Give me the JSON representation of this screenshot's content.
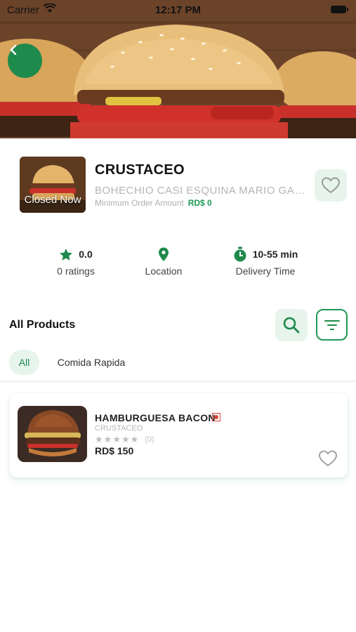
{
  "status_bar": {
    "carrier": "Carrier",
    "time": "12:17 PM"
  },
  "restaurant": {
    "name": "CRUSTACEO",
    "status": "Closed Now",
    "address": "BOHECHIO CASI ESQUINA MARIO GARCIA",
    "min_order_label": "Minimum Order Amount",
    "min_order_amount": "RD$ 0"
  },
  "stats": {
    "rating_value": "0.0",
    "rating_label": "0 ratings",
    "location_label": "Location",
    "delivery_value": "10-55 min",
    "delivery_label": "Delivery Time"
  },
  "products_section": {
    "title": "All Products"
  },
  "categories": [
    {
      "label": "All",
      "selected": true
    },
    {
      "label": "Comida Rapida",
      "selected": false
    }
  ],
  "products": [
    {
      "name": "HAMBURGUESA BACON",
      "restaurant": "CRUSTACEO",
      "rating": 0,
      "rating_count": "(0)",
      "price": "RD$ 150",
      "favorite": false
    }
  ],
  "icons": {
    "back": "chevron-left-icon",
    "favorite": "heart-outline-icon",
    "rating": "star-icon",
    "location": "map-pin-icon",
    "delivery": "stopwatch-icon",
    "search": "search-icon",
    "filter": "filter-icon"
  },
  "colors": {
    "accent": "#1e9a55",
    "accent_dark": "#1e8a4c",
    "accent_light": "#e6f4ec",
    "non_veg_mark": "#e0443a"
  }
}
